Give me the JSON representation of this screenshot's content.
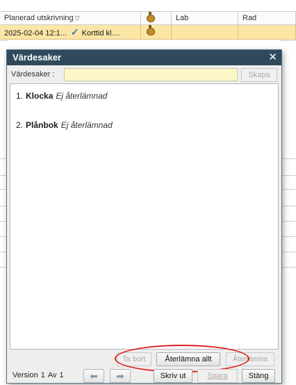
{
  "grid": {
    "columns": [
      "Planerad utskrivning",
      "",
      "Lab",
      "Rad"
    ],
    "sort_glyph": "▽",
    "selected_row": {
      "date": "2025-02-04 12:1...",
      "status_icon": "checkmark-icon",
      "type": "Korttid kl...."
    },
    "colors": {
      "selected_row": "#fbe6a6"
    }
  },
  "dialog": {
    "title": "Värdesaker",
    "close_glyph": "✕",
    "field_label": "Värdesaker :",
    "field_value": "",
    "create_label": "Skapa",
    "items": [
      {
        "num": "1.",
        "name": "Klocka",
        "status": "Ej återlämnad"
      },
      {
        "num": "2.",
        "name": "Plånbok",
        "status": "Ej återlämnad"
      }
    ],
    "remove_label": "Ta bort",
    "return_all_label": "Återlämna allt",
    "return_label": "Återlämna",
    "version_label": "Version",
    "version_current": "1",
    "version_of": "Av",
    "version_total": "1",
    "print_label": "Skriv ut",
    "save_label": "Spara",
    "close_label": "Stäng",
    "colors": {
      "titlebar": "#2f4a5c",
      "input_bg": "#fdf6c8",
      "highlight": "#e02020"
    }
  }
}
